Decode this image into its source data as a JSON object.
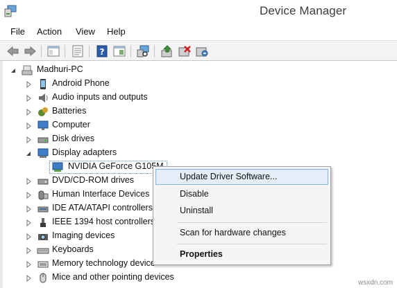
{
  "window": {
    "title": "Device Manager"
  },
  "menu": {
    "items": [
      "File",
      "Action",
      "View",
      "Help"
    ]
  },
  "toolbar": {
    "buttons": [
      "back-icon",
      "forward-icon",
      "console-tree-icon",
      "properties-icon",
      "help-icon",
      "show-hide-icon",
      "scan-hardware-icon",
      "update-driver-icon",
      "disable-device-icon",
      "uninstall-device-icon"
    ]
  },
  "tree": {
    "root": "Madhuri-PC",
    "categories": [
      {
        "label": "Android Phone",
        "icon": "phone-icon",
        "expanded": false
      },
      {
        "label": "Audio inputs and outputs",
        "icon": "speaker-icon",
        "expanded": false
      },
      {
        "label": "Batteries",
        "icon": "battery-icon",
        "expanded": false
      },
      {
        "label": "Computer",
        "icon": "monitor-icon",
        "expanded": false
      },
      {
        "label": "Disk drives",
        "icon": "disk-drive-icon",
        "expanded": false
      },
      {
        "label": "Display adapters",
        "icon": "display-adapter-icon",
        "expanded": true
      },
      {
        "label": "NVIDIA GeForce G105M",
        "icon": "display-adapter-icon",
        "child": true,
        "selected": true
      },
      {
        "label": "DVD/CD-ROM drives",
        "icon": "dvd-drive-icon",
        "expanded": false
      },
      {
        "label": "Human Interface Devices",
        "icon": "hid-icon",
        "expanded": false
      },
      {
        "label": "IDE ATA/ATAPI controllers",
        "icon": "ide-controller-icon",
        "expanded": false
      },
      {
        "label": "IEEE 1394 host controllers",
        "icon": "ieee1394-icon",
        "expanded": false
      },
      {
        "label": "Imaging devices",
        "icon": "camera-icon",
        "expanded": false
      },
      {
        "label": "Keyboards",
        "icon": "keyboard-icon",
        "expanded": false
      },
      {
        "label": "Memory technology devices",
        "icon": "memory-icon",
        "expanded": false
      },
      {
        "label": "Mice and other pointing devices",
        "icon": "mouse-icon",
        "expanded": false
      }
    ]
  },
  "context_menu": {
    "items": [
      {
        "label": "Update Driver Software...",
        "highlighted": true
      },
      {
        "label": "Disable"
      },
      {
        "label": "Uninstall"
      },
      {
        "label": "Scan for hardware changes"
      },
      {
        "label": "Properties",
        "bold": true
      }
    ]
  },
  "colors": {
    "highlight_bg": "#e3eef9",
    "highlight_border": "#7eb4ea",
    "toolbar_bg": "#f3f3f3"
  },
  "watermark": "wsxdn.com"
}
